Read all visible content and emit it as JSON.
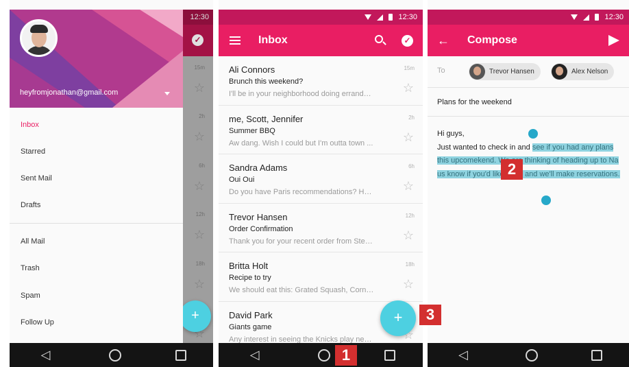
{
  "status": {
    "time": "12:30"
  },
  "drawer": {
    "email": "heyfromjonathan@gmail.com",
    "items": [
      "Inbox",
      "Starred",
      "Sent Mail",
      "Drafts"
    ],
    "items_secondary": [
      "All Mail",
      "Trash",
      "Spam",
      "Follow Up"
    ],
    "bg_times": [
      "15m",
      "2h",
      "6h",
      "12h",
      "18h"
    ]
  },
  "inbox": {
    "title": "Inbox",
    "emails": [
      {
        "sender": "Ali Connors",
        "subject": "Brunch this weekend?",
        "preview": "I'll be in your neighborhood doing errands ...",
        "time": "15m"
      },
      {
        "sender": "me, Scott, Jennifer",
        "subject": "Summer BBQ",
        "preview": "Aw dang. Wish I could but I'm outta town ...",
        "time": "2h"
      },
      {
        "sender": "Sandra Adams",
        "subject": "Oui Oui",
        "preview": "Do you have Paris recommendations? Hav...",
        "time": "6h"
      },
      {
        "sender": "Trevor Hansen",
        "subject": "Order Confirmation",
        "preview": "Thank you for your recent order from Stev...",
        "time": "12h"
      },
      {
        "sender": "Britta Holt",
        "subject": "Recipe to try",
        "preview": "We should eat this: Grated Squash, Corn, ...",
        "time": "18h"
      },
      {
        "sender": "David Park",
        "subject": "Giants game",
        "preview": "Any interest in seeing the Knicks play next ...",
        "time": ""
      }
    ]
  },
  "compose": {
    "title": "Compose",
    "to_label": "To",
    "recipients": [
      "Trevor Hansen",
      "Alex Nelson"
    ],
    "subject": "Plans for the weekend",
    "body_greeting": "Hi guys,",
    "body_plain": "Just wanted to check in and ",
    "body_sel_1": "see if you had any plans this upcom",
    "body_sel_2": "ekend. We are thinking of heading up to Na",
    "body_sel_3": " us know if you'd like to go and we'll make reservations."
  },
  "callouts": [
    "1",
    "2",
    "3"
  ],
  "glyphs": {
    "star": "☆",
    "plus": "+",
    "back": "←",
    "check": "✓",
    "nav_back": "◁"
  },
  "colors": {
    "primary": "#e91e63",
    "primary_dark": "#c2185b",
    "fab": "#4dd0e1",
    "badge": "#d32f2f",
    "selection": "#8fd3e0"
  }
}
